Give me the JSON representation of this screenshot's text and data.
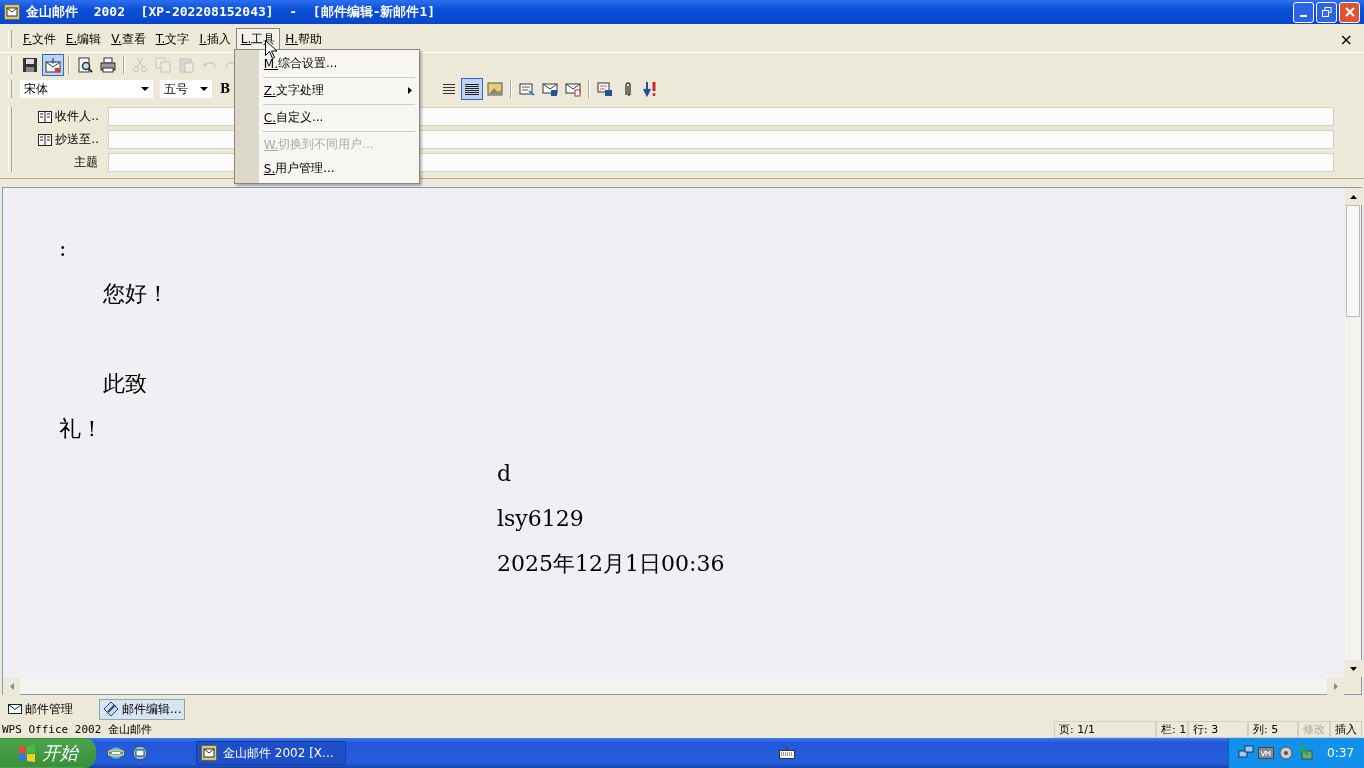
{
  "window": {
    "title": "金山邮件  2002  [XP-202208152043]  -  [邮件编辑-新邮件1]"
  },
  "menubar": {
    "items": [
      {
        "key": "F.",
        "label": "文件",
        "selected": false
      },
      {
        "key": "E.",
        "label": "编辑",
        "selected": false
      },
      {
        "key": "V.",
        "label": "查看",
        "selected": false
      },
      {
        "key": "T.",
        "label": "文字",
        "selected": false
      },
      {
        "key": "I.",
        "label": "插入",
        "selected": false
      },
      {
        "key": "L.",
        "label": "工具",
        "selected": true
      },
      {
        "key": "H.",
        "label": "帮助",
        "selected": false
      }
    ],
    "close": "×"
  },
  "tools_menu": {
    "items": [
      {
        "kind": "item",
        "key": "M.",
        "label": "综合设置...",
        "disabled": false,
        "submenu": false
      },
      {
        "kind": "separator"
      },
      {
        "kind": "item",
        "key": "Z.",
        "label": "文字处理",
        "disabled": false,
        "submenu": true
      },
      {
        "kind": "separator"
      },
      {
        "kind": "item",
        "key": "C.",
        "label": "自定义...",
        "disabled": false,
        "submenu": false
      },
      {
        "kind": "separator"
      },
      {
        "kind": "item",
        "key": "W.",
        "label": "切换到不同用户...",
        "disabled": true,
        "submenu": false
      },
      {
        "kind": "item",
        "key": "S.",
        "label": "用户管理...",
        "disabled": false,
        "submenu": false
      }
    ]
  },
  "toolbar": {
    "buttons": [
      {
        "kind": "button",
        "disabled": false,
        "selected": false
      },
      {
        "kind": "button",
        "disabled": false,
        "selected": true
      },
      {
        "kind": "separator"
      },
      {
        "kind": "button",
        "disabled": false,
        "selected": false
      },
      {
        "kind": "button",
        "disabled": false,
        "selected": false
      },
      {
        "kind": "separator"
      },
      {
        "kind": "button",
        "disabled": true,
        "selected": false
      },
      {
        "kind": "button",
        "disabled": true,
        "selected": false
      },
      {
        "kind": "button",
        "disabled": true,
        "selected": false
      },
      {
        "kind": "button",
        "disabled": true,
        "selected": false
      },
      {
        "kind": "button",
        "disabled": true,
        "selected": false
      }
    ]
  },
  "format_bar": {
    "font": "宋体",
    "size": "五号",
    "bold": "B",
    "buttons": [
      {
        "kind": "button",
        "selected": false
      },
      {
        "kind": "button",
        "selected": true
      },
      {
        "kind": "button",
        "selected": false
      },
      {
        "kind": "separator"
      },
      {
        "kind": "button",
        "selected": false
      },
      {
        "kind": "button",
        "selected": false
      },
      {
        "kind": "button",
        "selected": false
      },
      {
        "kind": "separator"
      },
      {
        "kind": "button",
        "selected": false
      },
      {
        "kind": "button",
        "selected": false
      },
      {
        "kind": "button",
        "selected": false
      }
    ]
  },
  "header_fields": [
    {
      "label": "收件人..",
      "button": true
    },
    {
      "label": "抄送至..",
      "button": true
    },
    {
      "label": "主题",
      "button": false
    }
  ],
  "body": {
    "lines": [
      {
        "text": ":",
        "indent": false
      },
      {
        "text": "您好！",
        "indent": true
      },
      {
        "text": "此致",
        "indent": true
      },
      {
        "text": "礼！",
        "indent": false
      }
    ],
    "signature": [
      "d",
      "lsy6129",
      "2025年12月1日00:36"
    ]
  },
  "bottom_tabs": [
    {
      "label": "邮件管理",
      "selected": false
    },
    {
      "label": "邮件编辑...",
      "selected": true
    }
  ],
  "status_bar": {
    "app": "WPS Office 2002 金山邮件",
    "panes": [
      {
        "text": "页: 1/1",
        "disabled": false
      },
      {
        "text": "栏: 1",
        "disabled": false
      },
      {
        "text": "行: 3",
        "disabled": false
      },
      {
        "text": "列: 5",
        "disabled": false
      },
      {
        "text": "修改",
        "disabled": true
      },
      {
        "text": "插入",
        "disabled": false
      }
    ]
  },
  "taskbar": {
    "start": "开始",
    "task": "金山邮件 2002 [X...",
    "clock": "0:37"
  }
}
